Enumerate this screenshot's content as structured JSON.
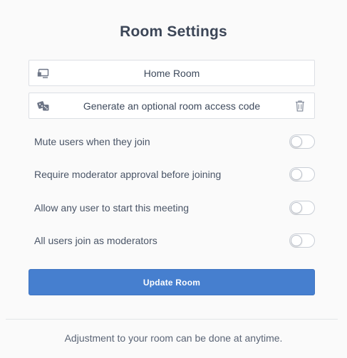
{
  "dialog": {
    "title": "Room Settings",
    "room_name": {
      "value": "Home Room",
      "icon": "room-name-icon"
    },
    "access_code": {
      "value": "Generate an optional room access code",
      "icon": "dice-icon",
      "delete_icon": "trash-icon"
    },
    "toggles": [
      {
        "label": "Mute users when they join",
        "enabled": false
      },
      {
        "label": "Require moderator approval before joining",
        "enabled": false
      },
      {
        "label": "Allow any user to start this meeting",
        "enabled": false
      },
      {
        "label": "All users join as moderators",
        "enabled": false
      }
    ],
    "update_button": "Update Room",
    "footer_note": "Adjustment to your room can be done at anytime.",
    "colors": {
      "primary": "#467fcf",
      "text": "#3e4a5c",
      "border": "#dcdfe4"
    }
  }
}
